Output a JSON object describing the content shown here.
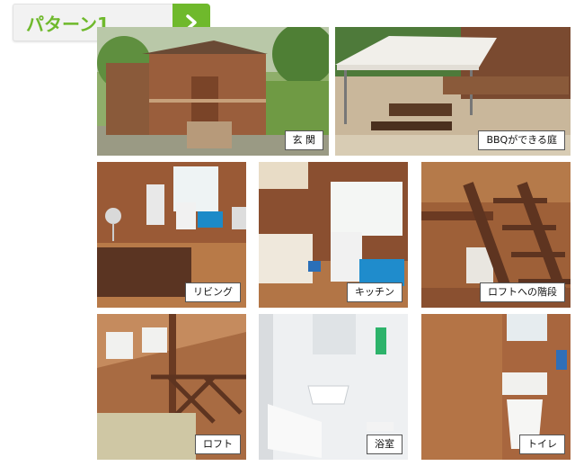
{
  "header": {
    "title": "パターン1",
    "toggle_icon": "chevron-right-icon",
    "accent_color": "#6fb92c"
  },
  "gallery": {
    "items": [
      {
        "caption": "玄 関"
      },
      {
        "caption": "BBQができる庭"
      },
      {
        "caption": "リビング"
      },
      {
        "caption": "キッチン"
      },
      {
        "caption": "ロフトへの階段"
      },
      {
        "caption": "ロフト"
      },
      {
        "caption": "浴室"
      },
      {
        "caption": "トイレ"
      }
    ]
  }
}
